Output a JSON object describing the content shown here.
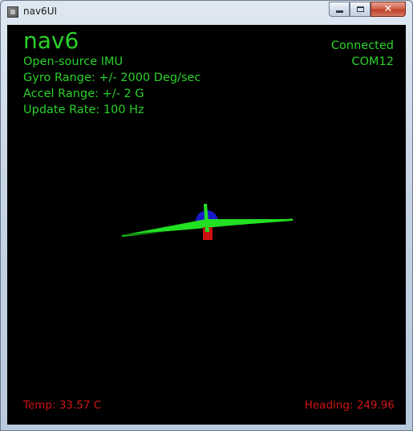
{
  "window": {
    "title": "nav6UI",
    "minimize_label": "",
    "maximize_label": "",
    "close_label": "✕"
  },
  "header": {
    "title": "nav6",
    "subtitle": "Open-source IMU",
    "gyro": "Gyro Range:  +/- 2000 Deg/sec",
    "accel": "Accel Range:  +/- 2 G",
    "rate": "Update Rate:  100 Hz"
  },
  "status": {
    "connection": "Connected",
    "port": "COM12"
  },
  "footer": {
    "temp": "Temp:  33.57 C",
    "heading": "Heading:  249.96"
  },
  "colors": {
    "text_green": "#2ad12a",
    "text_red": "#d01515",
    "wing_green": "#22e022",
    "fuselage_blue": "#1a1acc",
    "tail_red": "#cc1111",
    "background": "#000000"
  }
}
